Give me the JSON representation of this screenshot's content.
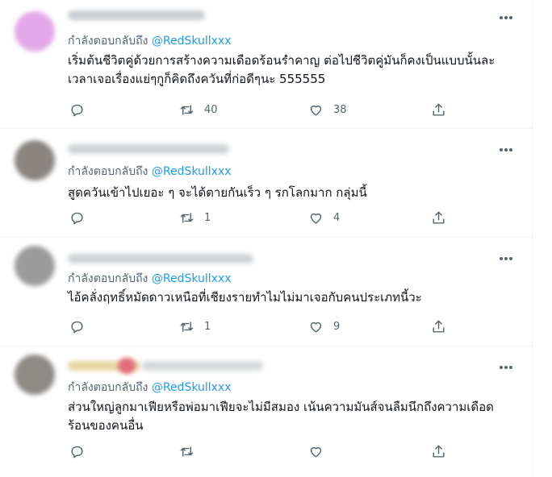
{
  "reply_prefix": "กำลังตอบกลับถึง",
  "accent_color": "#1d9bf0",
  "tweets": [
    {
      "mention": "@RedSkullxxx",
      "text": "เริ่มต้นชีวิตคู่ด้วยการสร้างความเดือดร้อนรำคาญ ต่อไปชีวิตคู่มันก็คงเป็นแบบนั้นละ\nเวลาเจอเรื่องแย่ๆกูก็คิดถึงควันที่ก่อดีๆนะ 555555",
      "retweets": "40",
      "likes": "38"
    },
    {
      "mention": "@RedSkullxxx",
      "text": "สูดควันเข้าไปเยอะ ๆ จะได้ตายกันเร็ว ๆ รกโลกมาก กลุ่มนี้",
      "retweets": "1",
      "likes": "4"
    },
    {
      "mention": "@RedSkullxxx",
      "text": "ไอ้คลั่งฤทธิ์หมัดดาวเหนือที่เชียงรายทำไมไม่มาเจอกับคนประเภทนี้วะ",
      "retweets": "1",
      "likes": "9"
    },
    {
      "mention": "@RedSkullxxx",
      "text": "ส่วนใหญ่ลูกมาเฟียหรือพ่อมาเฟียจะไม่มีสมอง เน้นความมันส์จนลืมนึกถึงความเดือด\nร้อนของคนอื่น",
      "retweets": "",
      "likes": ""
    }
  ],
  "icons": [
    "more-icon",
    "reply-icon",
    "retweet-icon",
    "like-icon",
    "share-icon"
  ]
}
